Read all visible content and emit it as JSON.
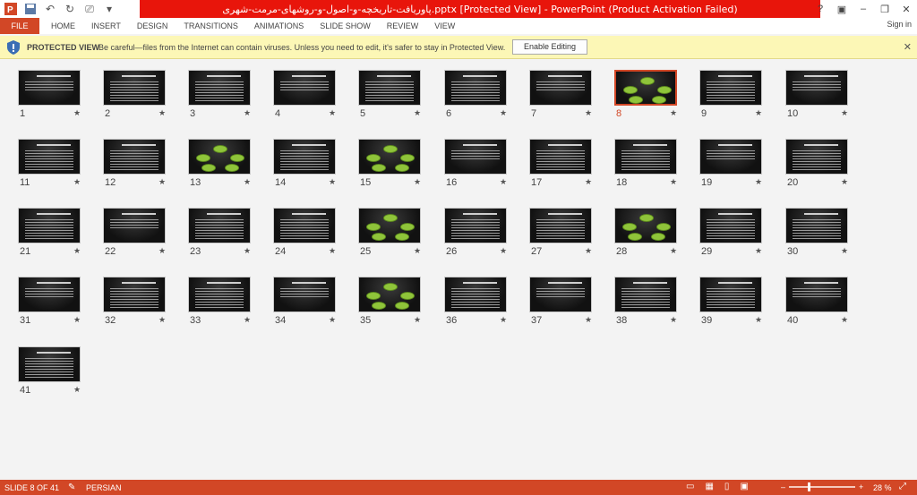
{
  "window": {
    "title": "پاوریافت-تاریخچه-و-اصول-و-روشهای-مرمت-شهری.pptx [Protected View] -  PowerPoint (Product Activation Failed)",
    "controls": [
      "?",
      "▣",
      "–",
      "❐",
      "✕"
    ],
    "sign_in": "Sign in"
  },
  "ribbon": {
    "file": "FILE",
    "tabs": [
      "HOME",
      "INSERT",
      "DESIGN",
      "TRANSITIONS",
      "ANIMATIONS",
      "SLIDE SHOW",
      "REVIEW",
      "VIEW"
    ]
  },
  "protected": {
    "title": "PROTECTED VIEW",
    "message": "Be careful—files from the Internet can contain viruses. Unless you need to edit, it's safer to stay in Protected View.",
    "button": "Enable Editing",
    "close": "✕"
  },
  "slides": {
    "selected": 8,
    "count": 41,
    "star": "★",
    "diagram_slides": [
      8,
      13,
      15,
      25,
      28,
      35
    ]
  },
  "status": {
    "slide_info": "SLIDE 8 OF 41",
    "language": "PERSIAN",
    "zoom": "28 %",
    "zoom_fraction": 0.28,
    "minus": "–",
    "plus": "+"
  },
  "colors": {
    "accent": "#d24726",
    "title_bar": "#e8150b",
    "protected_bar": "#fcf7b6"
  }
}
